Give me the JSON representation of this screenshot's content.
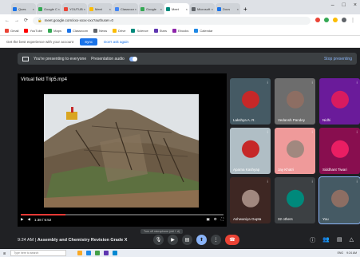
{
  "tabs": [
    {
      "title": "Ques",
      "color": "#1a73e8"
    },
    {
      "title": "Google Cl",
      "color": "#34a853"
    },
    {
      "title": "YOUTUBE",
      "color": "#ea4335"
    },
    {
      "title": "Meet",
      "color": "#fbbc04"
    },
    {
      "title": "Classroom",
      "color": "#4285f4"
    },
    {
      "title": "Google",
      "color": "#34a853"
    },
    {
      "title": "Meet",
      "color": "#00897b",
      "active": true
    },
    {
      "title": "Microsoft",
      "color": "#5f6368"
    },
    {
      "title": "Docs",
      "color": "#1a73e8"
    }
  ],
  "address": {
    "url": "meet.google.com/xxx-xxxx-xxx?authuser=0"
  },
  "bookmarks": [
    "Gmail",
    "YouTube",
    "Maps",
    "Classroom",
    "News",
    "Drive",
    "Science",
    "Stars",
    "Ebooks",
    "Calendar"
  ],
  "notification": {
    "text": "Get the best experience with your account",
    "button": "Sync",
    "secondary": "Don't ask again"
  },
  "presenting_bar": {
    "text": "You're presenting to everyone",
    "audio_label": "Presentation audio",
    "stop_label": "Stop presenting"
  },
  "video": {
    "title": "Virtual field Trip5.mp4",
    "time": "1:38 / 5:52",
    "progress": 0.22
  },
  "participants": [
    {
      "name": "Lakshya A. R.",
      "color": "#455a64",
      "avatar": "#c62828"
    },
    {
      "name": "Vedansh Pandey",
      "color": "#6d6d6d",
      "avatar": "#8d6e63"
    },
    {
      "name": "Nidhi",
      "color": "#6a1b9a",
      "avatar": "#d81b60"
    },
    {
      "name": "Aparna Kashyap",
      "color": "#b0bec5",
      "avatar": "#c62828"
    },
    {
      "name": "Jay Khatri",
      "color": "#ef9a9a",
      "avatar": "#a1887f"
    },
    {
      "name": "Siddhant Tiwari",
      "color": "#880e4f",
      "avatar": "#e91e63"
    },
    {
      "name": "Ashwaniya Gupta",
      "color": "#3e2723",
      "avatar": "#a1887f"
    },
    {
      "name": "32 others",
      "color": "#3c4043",
      "avatar": "#00897b"
    },
    {
      "name": "You",
      "color": "#455a64",
      "avatar": "#8d6e63",
      "highlighted": true
    }
  ],
  "meeting": {
    "time": "9:24 AM",
    "title": "Assembly and Chemistry Revision Grade X"
  },
  "controls": [
    "mic-icon",
    "camera-icon",
    "captions-icon",
    "present-icon",
    "more-icon",
    "end-call-icon"
  ],
  "controls_tooltip": "Turn off microphone (ctrl + d)",
  "right_controls": [
    "info-icon",
    "people-icon",
    "chat-icon",
    "activities-icon"
  ],
  "taskbar": {
    "search_placeholder": "Type here to search",
    "tray": "ENG",
    "clock": "9:24 AM"
  }
}
